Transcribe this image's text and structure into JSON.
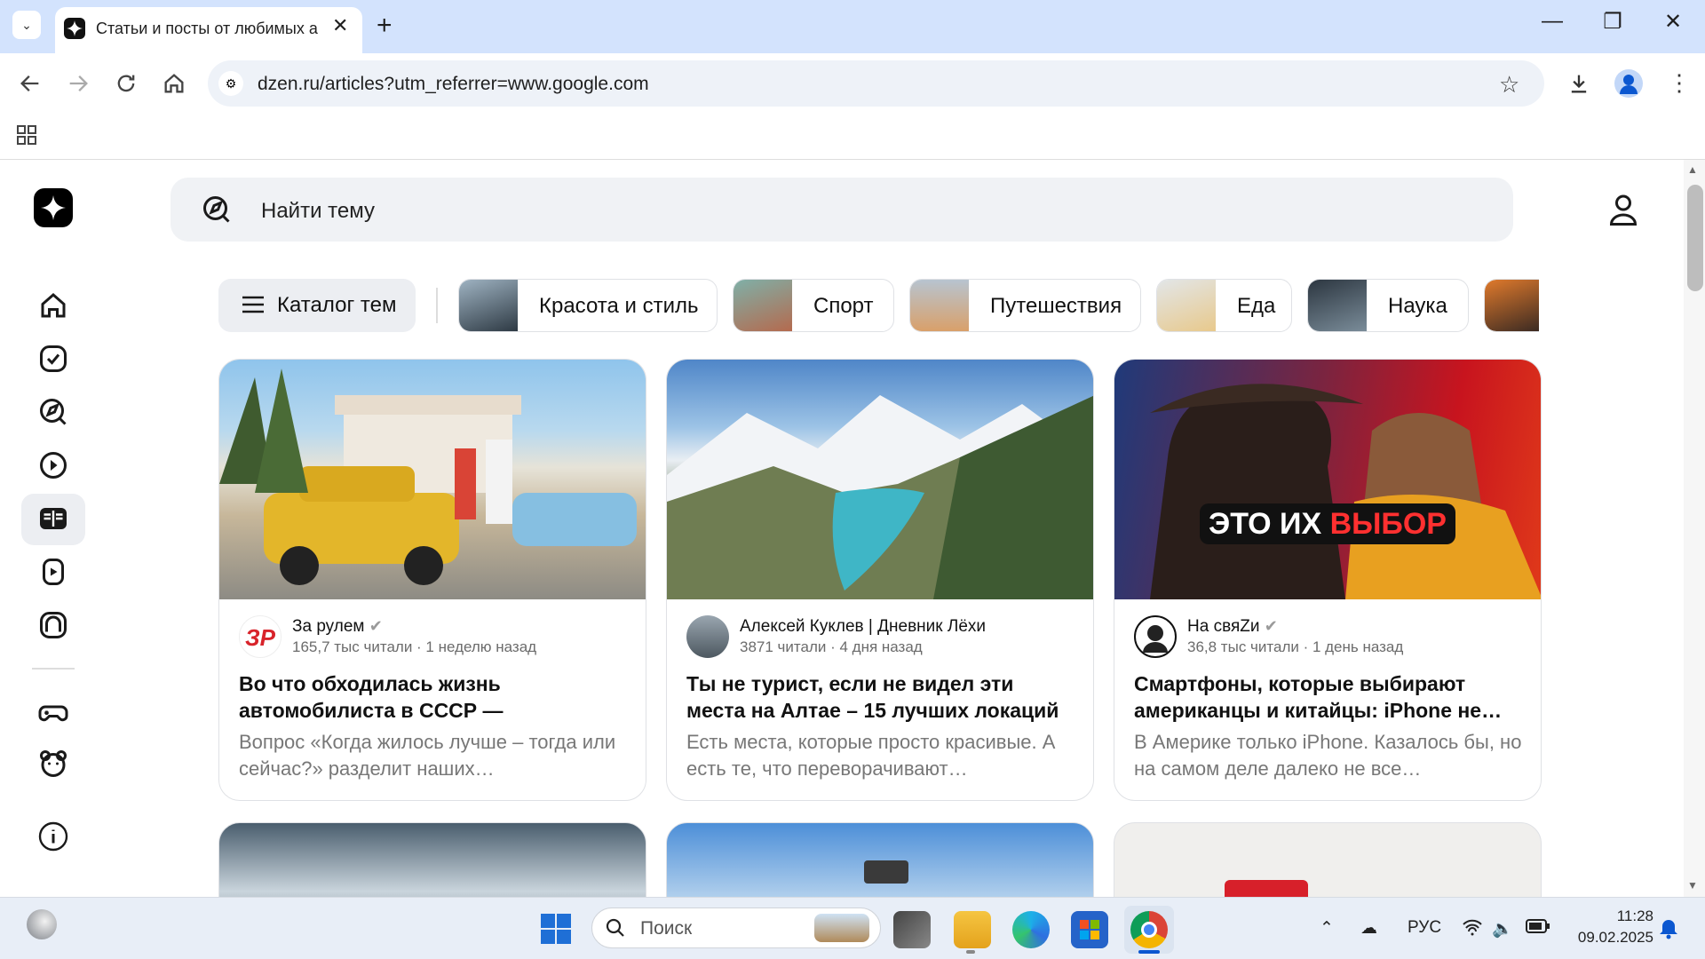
{
  "browser": {
    "tab_title": "Статьи и посты от любимых ав",
    "url": "dzen.ru/articles?utm_referrer=www.google.com",
    "tab_close_glyph": "✕",
    "new_tab_glyph": "+",
    "window_controls": {
      "minimize": "—",
      "restore": "❐",
      "close": "✕"
    }
  },
  "search": {
    "placeholder": "Найти тему"
  },
  "categories": [
    {
      "label": "Каталог тем"
    },
    {
      "label": "Красота и стиль",
      "color": "#6d7f8c"
    },
    {
      "label": "Спорт",
      "color": "#b46a4e"
    },
    {
      "label": "Путешествия",
      "color": "#d9a06a"
    },
    {
      "label": "Еда",
      "color": "#e8c98c"
    },
    {
      "label": "Наука",
      "color": "#4f5b66"
    }
  ],
  "cards": [
    {
      "source": "За рулем",
      "verified": true,
      "meta": "165,7 тыс читали · 1 неделю назад",
      "title": "Во что обходилась жизнь автомобилиста в СССР — вспомнил…",
      "snippet": "Вопрос «Когда жилось лучше – тогда или сейчас?» разделит наших…",
      "avatar_text": "ЗР"
    },
    {
      "source": "Алексей Куклев | Дневник Лёхи",
      "verified": false,
      "meta": "3871 читали · 4 дня назад",
      "title": "Ты не турист, если не видел эти места на Алтае – 15 лучших локаций",
      "snippet": "Есть места, которые просто красивые. А есть те, что переворачивают…"
    },
    {
      "source": "На свяZи",
      "verified": true,
      "meta": "36,8 тыс читали · 1 день назад",
      "title": "Смартфоны, которые выбирают американцы и китайцы: iPhone не…",
      "snippet": "В Америке только iPhone. Казалось бы, но на самом деле далеко не все…",
      "overlay_text_1": "ЭТО ИХ",
      "overlay_text_2": "ВЫБОР"
    }
  ],
  "taskbar": {
    "search_placeholder": "Поиск",
    "language": "РУС",
    "time": "11:28",
    "date": "09.02.2025"
  },
  "colors": {
    "accent": "#0b57d0",
    "tab_strip": "#d3e3fd",
    "taskbar": "#e8eef7"
  }
}
